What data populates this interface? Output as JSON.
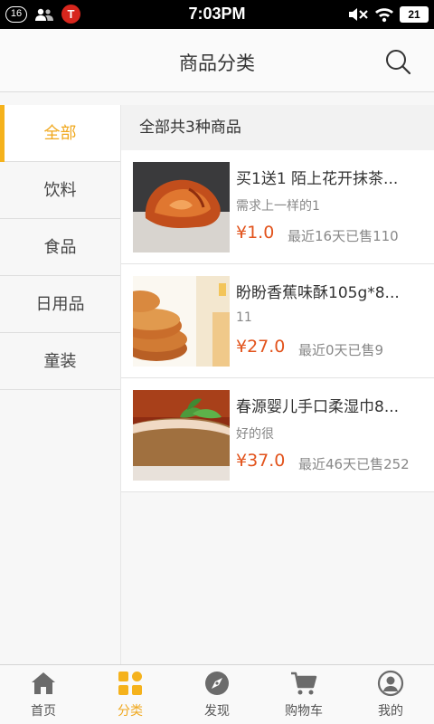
{
  "status_bar": {
    "notification_count": "16",
    "app_badge_letter": "T",
    "time": "7:03PM",
    "battery": "21"
  },
  "header": {
    "title": "商品分类",
    "search_icon": "search-icon"
  },
  "sidebar": {
    "items": [
      {
        "label": "全部",
        "active": true
      },
      {
        "label": "饮料",
        "active": false
      },
      {
        "label": "食品",
        "active": false
      },
      {
        "label": "日用品",
        "active": false
      },
      {
        "label": "童装",
        "active": false
      }
    ]
  },
  "main": {
    "count_text": "全部共3种商品",
    "products": [
      {
        "title": "买1送1 陌上花开抹茶...",
        "desc": "需求上一样的1",
        "price": "¥1.0",
        "sold": "最近16天已售110"
      },
      {
        "title": "盼盼香蕉味酥105g*8...",
        "desc": "11",
        "price": "¥27.0",
        "sold": "最近0天已售9"
      },
      {
        "title": "春源婴儿手口柔湿巾8...",
        "desc": "好的很",
        "price": "¥37.0",
        "sold": "最近46天已售252"
      }
    ]
  },
  "tabbar": {
    "tabs": [
      {
        "label": "首页",
        "icon": "home-icon",
        "active": false
      },
      {
        "label": "分类",
        "icon": "category-icon",
        "active": true
      },
      {
        "label": "发现",
        "icon": "compass-icon",
        "active": false
      },
      {
        "label": "购物车",
        "icon": "cart-icon",
        "active": false
      },
      {
        "label": "我的",
        "icon": "profile-icon",
        "active": false
      }
    ]
  },
  "colors": {
    "accent": "#f5b21c",
    "price": "#e2531c",
    "status_bar": "#000000"
  }
}
